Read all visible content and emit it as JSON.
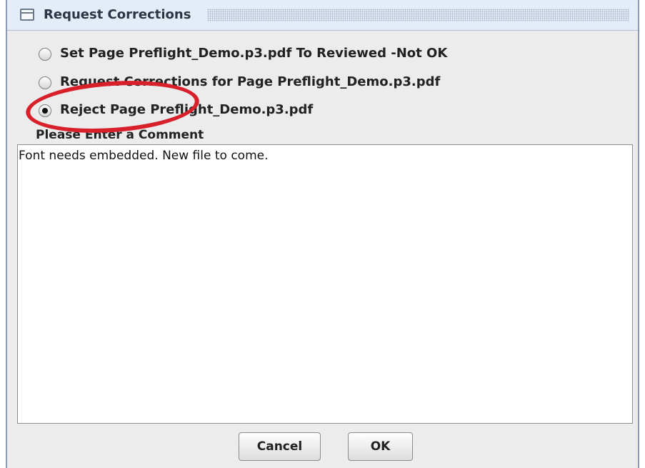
{
  "dialog": {
    "title": "Request Corrections"
  },
  "options": [
    {
      "label": "Set Page Preflight_Demo.p3.pdf To Reviewed -Not OK",
      "selected": false
    },
    {
      "label": "Request Corrections for Page Preflight_Demo.p3.pdf",
      "selected": false
    },
    {
      "label": "Reject Page Preflight_Demo.p3.pdf",
      "selected": true
    }
  ],
  "comment": {
    "label": "Please Enter a Comment",
    "value": "Font needs embedded. New file to come."
  },
  "buttons": {
    "cancel_label": "Cancel",
    "ok_label": "OK"
  },
  "icons": {
    "title": "window-icon",
    "annotation": "highlight-circle"
  },
  "colors": {
    "annotation": "#d8202b",
    "title_bar": "#e4ecf7"
  }
}
